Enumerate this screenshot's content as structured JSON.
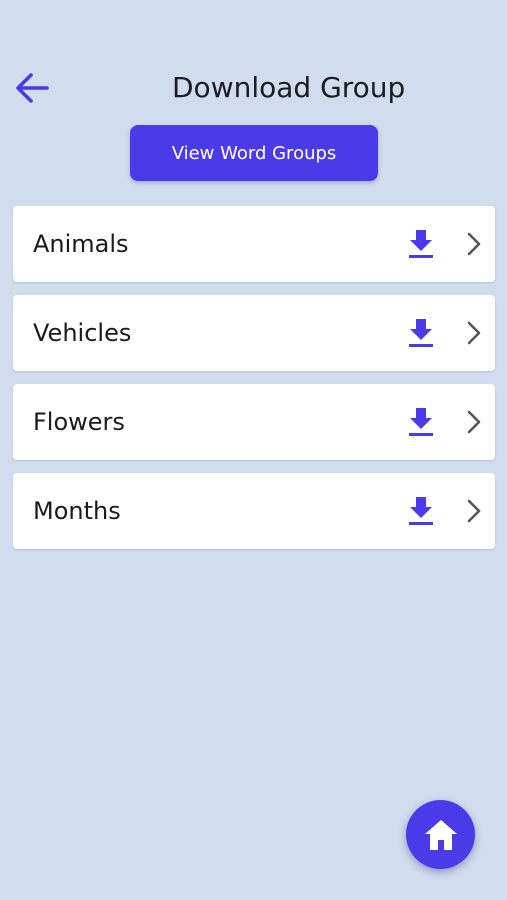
{
  "header": {
    "title": "Download Group",
    "back_icon": "arrow-left-icon"
  },
  "actions": {
    "view_groups_label": "View Word Groups"
  },
  "groups": [
    {
      "label": "Animals"
    },
    {
      "label": "Vehicles"
    },
    {
      "label": "Flowers"
    },
    {
      "label": "Months"
    }
  ],
  "icons": {
    "download": "download-icon",
    "chevron": "chevron-right-icon",
    "home": "home-icon"
  },
  "colors": {
    "accent": "#4b3ae8",
    "background": "#cfddee",
    "card": "#ffffff",
    "title_text": "#1c1c22",
    "chevron": "#55575c"
  }
}
